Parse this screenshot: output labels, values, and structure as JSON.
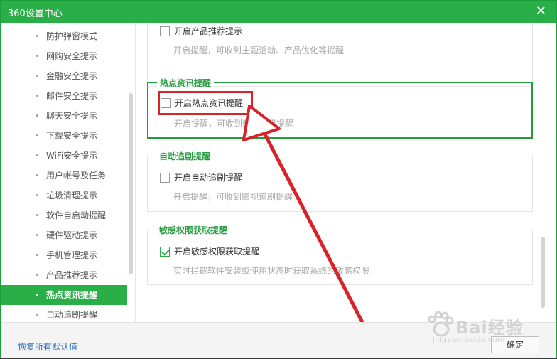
{
  "window": {
    "title": "360设置中心",
    "close_icon": "close-icon"
  },
  "sidebar": {
    "items": [
      {
        "label": "防护弹窗模式",
        "active": false
      },
      {
        "label": "网购安全提示",
        "active": false
      },
      {
        "label": "金融安全提示",
        "active": false
      },
      {
        "label": "邮件安全提示",
        "active": false
      },
      {
        "label": "聊天安全提示",
        "active": false
      },
      {
        "label": "下载安全提示",
        "active": false
      },
      {
        "label": "WiFi安全提示",
        "active": false
      },
      {
        "label": "用户帐号及任务",
        "active": false
      },
      {
        "label": "垃圾清理提示",
        "active": false
      },
      {
        "label": "软件自启动提醒",
        "active": false
      },
      {
        "label": "硬件驱动提示",
        "active": false
      },
      {
        "label": "手机管理提示",
        "active": false
      },
      {
        "label": "产品推荐提示",
        "active": false
      },
      {
        "label": "热点资讯提醒",
        "active": true
      },
      {
        "label": "自动追剧提醒",
        "active": false
      }
    ]
  },
  "sections": {
    "product": {
      "checkbox_label": "开启产品推荐提示",
      "checked": false,
      "desc": "开启提醒，可收到主题活动、产品优化等提醒"
    },
    "hot": {
      "title": "热点资讯提醒",
      "checkbox_label": "开启热点资讯提醒",
      "checked": false,
      "desc": "开启提醒，可收到热点资讯提醒"
    },
    "drama": {
      "title": "自动追剧提醒",
      "checkbox_label": "开启自动追剧提醒",
      "checked": false,
      "desc": "开启提醒，可收到影视追剧提醒"
    },
    "perm": {
      "title": "敏感权限获取提醒",
      "checkbox_label": "开启敏感权限获取提醒",
      "checked": true,
      "desc": "实时拦截软件安装或使用状态时获取系统的敏感权限"
    }
  },
  "footer": {
    "reset_label": "恢复所有默认值",
    "ok_label": "确定"
  },
  "watermark": {
    "brand": "Bai经验",
    "url": "jingyan.baidu.com"
  },
  "colors": {
    "accent": "#2aae48",
    "annotation": "#d8232a"
  }
}
